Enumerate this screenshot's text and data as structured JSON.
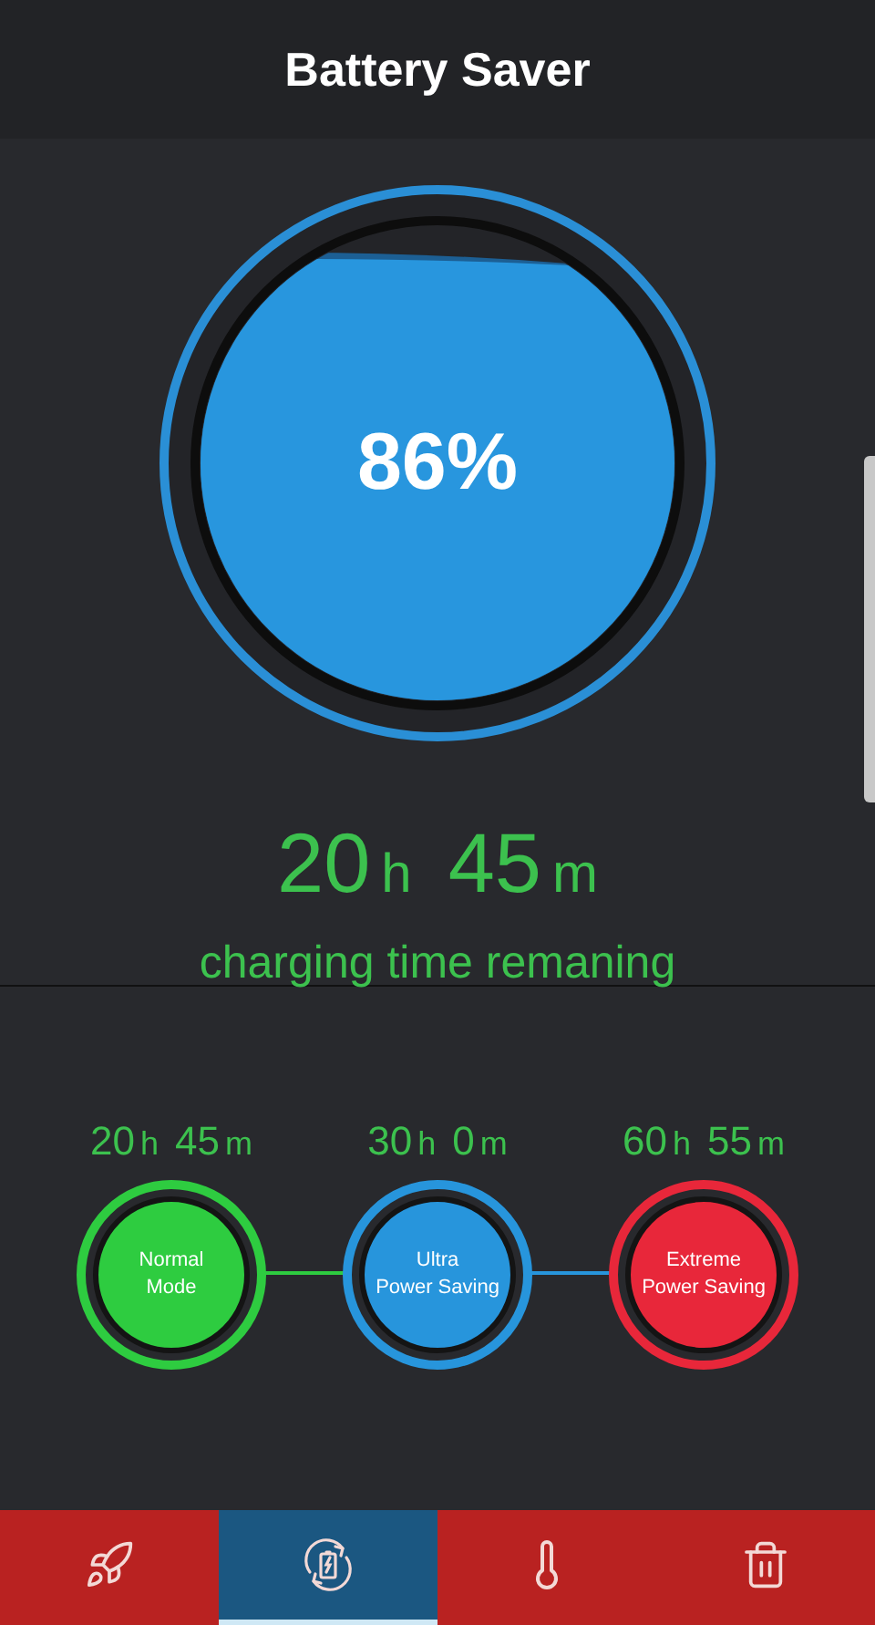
{
  "header": {
    "title": "Battery Saver"
  },
  "gauge": {
    "percent": "86%"
  },
  "remaining": {
    "time_parts": [
      {
        "text": "20",
        "kind": "number"
      },
      {
        "text": "h",
        "kind": "unit"
      },
      {
        "text": "45",
        "kind": "number"
      },
      {
        "text": "m",
        "kind": "unit"
      }
    ],
    "caption": "charging time remaning"
  },
  "modes": [
    {
      "time_parts": [
        {
          "text": "20",
          "kind": "number"
        },
        {
          "text": "h",
          "kind": "unit"
        },
        {
          "text": "45",
          "kind": "number"
        },
        {
          "text": "m",
          "kind": "unit"
        }
      ],
      "lines": [
        "Normal",
        "Mode"
      ],
      "color": "#2ecc40"
    },
    {
      "time_parts": [
        {
          "text": "30",
          "kind": "number"
        },
        {
          "text": "h",
          "kind": "unit"
        },
        {
          "text": "0",
          "kind": "number"
        },
        {
          "text": "m",
          "kind": "unit"
        }
      ],
      "lines": [
        "Ultra",
        "Power Saving"
      ],
      "color": "#2795dc"
    },
    {
      "time_parts": [
        {
          "text": "60",
          "kind": "number"
        },
        {
          "text": "h",
          "kind": "unit"
        },
        {
          "text": "55",
          "kind": "number"
        },
        {
          "text": "m",
          "kind": "unit"
        }
      ],
      "lines": [
        "Extreme",
        "Power Saving"
      ],
      "color": "#e8273a"
    }
  ],
  "nav": [
    {
      "kind": "rocket",
      "selected": false
    },
    {
      "kind": "battery",
      "selected": true
    },
    {
      "kind": "thermometer",
      "selected": false
    },
    {
      "kind": "trash",
      "selected": false
    }
  ]
}
